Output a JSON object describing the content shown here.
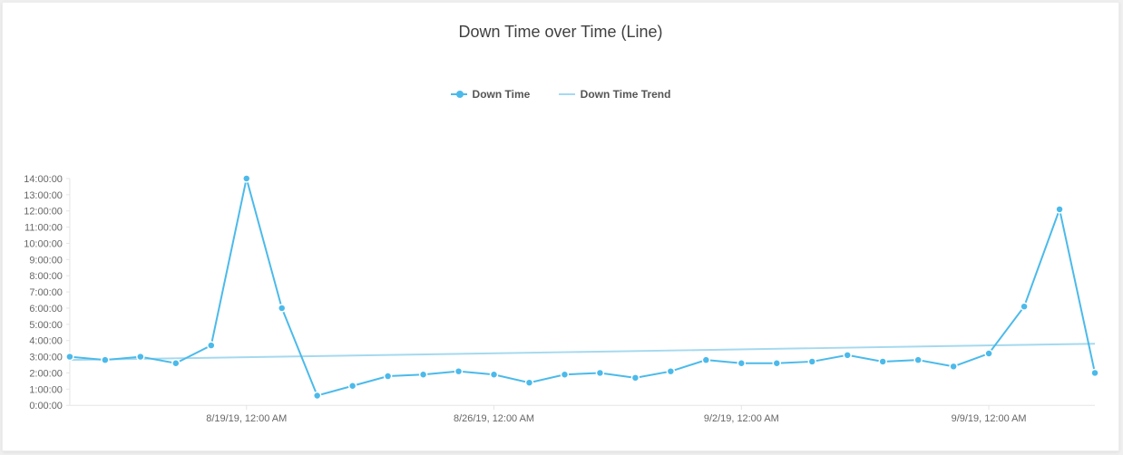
{
  "title": "Down Time over Time (Line)",
  "legend": {
    "series": "Down Time",
    "trend": "Down Time Trend"
  },
  "chart_data": {
    "type": "line",
    "ylabel": "",
    "xlabel": "",
    "y_unit": "duration_hms",
    "y_ticks": [
      "0:00:00",
      "1:00:00",
      "2:00:00",
      "3:00:00",
      "4:00:00",
      "5:00:00",
      "6:00:00",
      "7:00:00",
      "8:00:00",
      "9:00:00",
      "10:00:00",
      "11:00:00",
      "12:00:00",
      "13:00:00",
      "14:00:00"
    ],
    "ylim": [
      0,
      14
    ],
    "x_ticks": [
      {
        "index": 5,
        "label": "8/19/19, 12:00 AM"
      },
      {
        "index": 12,
        "label": "8/26/19, 12:00 AM"
      },
      {
        "index": 19,
        "label": "9/2/19, 12:00 AM"
      },
      {
        "index": 26,
        "label": "9/9/19, 12:00 AM"
      }
    ],
    "series": [
      {
        "name": "Down Time",
        "values_hours": [
          3.0,
          2.8,
          3.0,
          2.6,
          3.7,
          14.0,
          6.0,
          0.6,
          1.2,
          1.8,
          1.9,
          2.1,
          1.9,
          1.4,
          1.9,
          2.0,
          1.7,
          2.1,
          2.8,
          2.6,
          2.6,
          2.7,
          3.1,
          2.7,
          2.8,
          2.4,
          3.2,
          6.1,
          12.1,
          2.0
        ]
      },
      {
        "name": "Down Time Trend",
        "trend_start_hours": 2.8,
        "trend_end_hours": 3.8
      }
    ]
  }
}
